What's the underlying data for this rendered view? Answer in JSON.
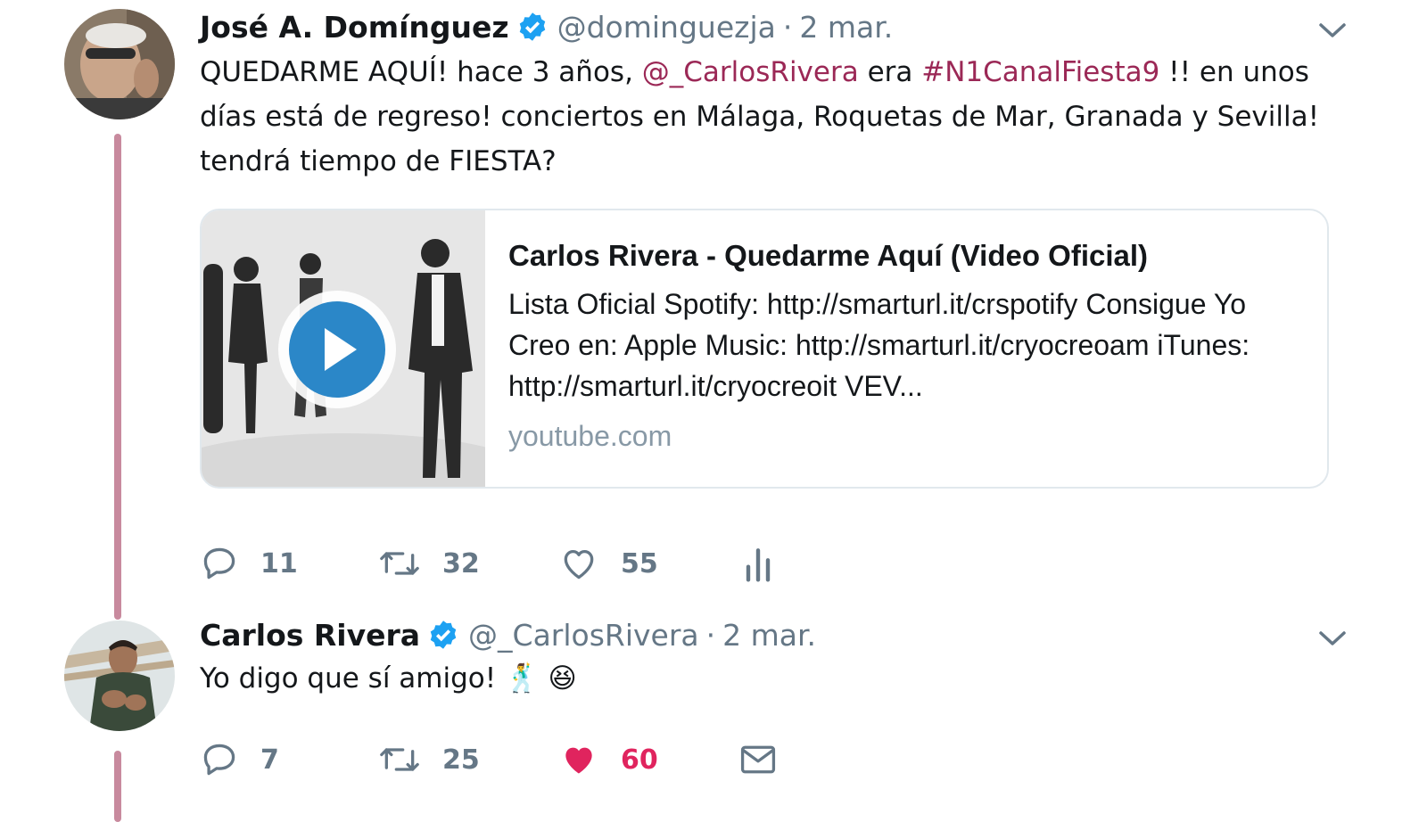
{
  "colors": {
    "link": "#9b2856",
    "verified": "#1da1f2",
    "muted": "#657786",
    "like_active": "#e0245e",
    "thread_line": "#c88a9e"
  },
  "tweets": [
    {
      "author_name": "José A. Domínguez",
      "verified": true,
      "handle": "@dominguezja",
      "separator": "·",
      "date": "2 mar.",
      "text_parts": [
        "QUEDARME AQUÍ! hace 3 años, ",
        "@_CarlosRivera",
        " era ",
        "#N1CanalFiesta9",
        " !! en unos días está de regreso! conciertos en Málaga, Roquetas de Mar, Granada y Sevilla! tendrá tiempo de FIESTA?"
      ],
      "card": {
        "title": "Carlos Rivera - Quedarme Aquí (Video Oficial)",
        "description": "Lista Oficial Spotify: http://smarturl.it/crspotify Consigue Yo Creo en: Apple Music: http://smarturl.it/cryocreoam iTunes: http://smarturl.it/cryocreoit VEV...",
        "domain": "youtube.com",
        "media_icon": "play-icon"
      },
      "actions": {
        "reply_count": "11",
        "retweet_count": "32",
        "like_count": "55",
        "liked": false,
        "extra_icon": "analytics-icon"
      }
    },
    {
      "author_name": "Carlos Rivera",
      "verified": true,
      "handle": "@_CarlosRivera",
      "separator": "·",
      "date": "2 mar.",
      "text": "Yo digo que sí amigo! 🕺 😆",
      "actions": {
        "reply_count": "7",
        "retweet_count": "25",
        "like_count": "60",
        "liked": true,
        "extra_icon": "envelope-icon"
      }
    }
  ]
}
